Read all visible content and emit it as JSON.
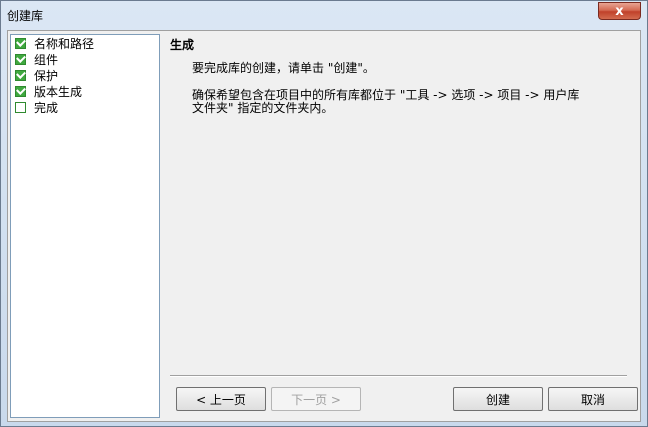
{
  "window": {
    "title": "创建库",
    "close_label": "x"
  },
  "steps": [
    {
      "label": "名称和路径",
      "checked": true
    },
    {
      "label": "组件",
      "checked": true
    },
    {
      "label": "保护",
      "checked": true
    },
    {
      "label": "版本生成",
      "checked": true
    },
    {
      "label": "完成",
      "checked": false
    }
  ],
  "main": {
    "heading": "生成",
    "line1": "要完成库的创建，请单击 \"创建\"。",
    "line2a": "确保希望包含在项目中的所有库都位于 \"工具 -> 选项 -> 项目 -> 用户库",
    "line2b": "文件夹\" 指定的文件夹内。"
  },
  "buttons": {
    "back": "< 上一页",
    "next": "下一页 >",
    "create": "创建",
    "cancel": "取消"
  }
}
